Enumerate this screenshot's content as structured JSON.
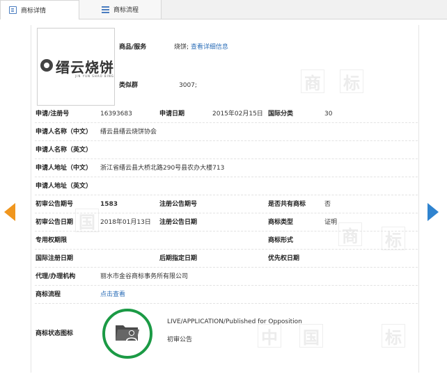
{
  "tabs": [
    {
      "label": "商标详情",
      "icon": "document-icon",
      "active": true
    },
    {
      "label": "商标流程",
      "icon": "list-icon",
      "active": false
    }
  ],
  "logo": {
    "text": "缙云烧饼",
    "subtext": "JIN YUN SHAO BING"
  },
  "watermark": [
    "中",
    "国",
    "商",
    "标"
  ],
  "goods": {
    "label": "商品/服务",
    "value": "烧饼;",
    "link": "查看详细信息"
  },
  "similar_group": {
    "label": "类似群",
    "value": "3007;"
  },
  "rows": {
    "reg_no": {
      "label": "申请/注册号",
      "value": "16393683"
    },
    "app_date": {
      "label": "申请日期",
      "value": "2015年02月15日"
    },
    "intl_class": {
      "label": "国际分类",
      "value": "30"
    },
    "name_cn": {
      "label": "申请人名称（中文）",
      "value": "缙云县缙云烧饼协会"
    },
    "name_en": {
      "label": "申请人名称（英文）",
      "value": ""
    },
    "addr_cn": {
      "label": "申请人地址（中文）",
      "value": "浙江省缙云县大桥北路290号县农办大楼713"
    },
    "addr_en": {
      "label": "申请人地址（英文）",
      "value": ""
    },
    "prelim_no": {
      "label": "初审公告期号",
      "value": "1583"
    },
    "reg_pub_no": {
      "label": "注册公告期号",
      "value": ""
    },
    "shared": {
      "label": "是否共有商标",
      "value": "否"
    },
    "prelim_date": {
      "label": "初审公告日期",
      "value": "2018年01月13日"
    },
    "reg_pub_date": {
      "label": "注册公告日期",
      "value": ""
    },
    "tm_type": {
      "label": "商标类型",
      "value": "证明"
    },
    "excl_period": {
      "label": "专用权期限",
      "value": ""
    },
    "tm_form": {
      "label": "商标形式",
      "value": ""
    },
    "intl_reg_date": {
      "label": "国际注册日期",
      "value": ""
    },
    "later_date": {
      "label": "后期指定日期",
      "value": ""
    },
    "priority_date": {
      "label": "优先权日期",
      "value": ""
    },
    "agent": {
      "label": "代理/办理机构",
      "value": "丽水市金谷商标事务所有限公司"
    },
    "flow": {
      "label": "商标流程",
      "link": "点击查看"
    },
    "status_icon": {
      "label": "商标状态图标"
    }
  },
  "status": {
    "text": "LIVE/APPLICATION/Published for Opposition",
    "sub": "初审公告",
    "icon": "folder-user-icon",
    "ring_color": "#1b9a45"
  },
  "nav": {
    "prev_icon": "arrow-left-icon",
    "next_icon": "arrow-right-icon",
    "prev_color": "#f0961e",
    "next_color": "#2f83cf"
  }
}
